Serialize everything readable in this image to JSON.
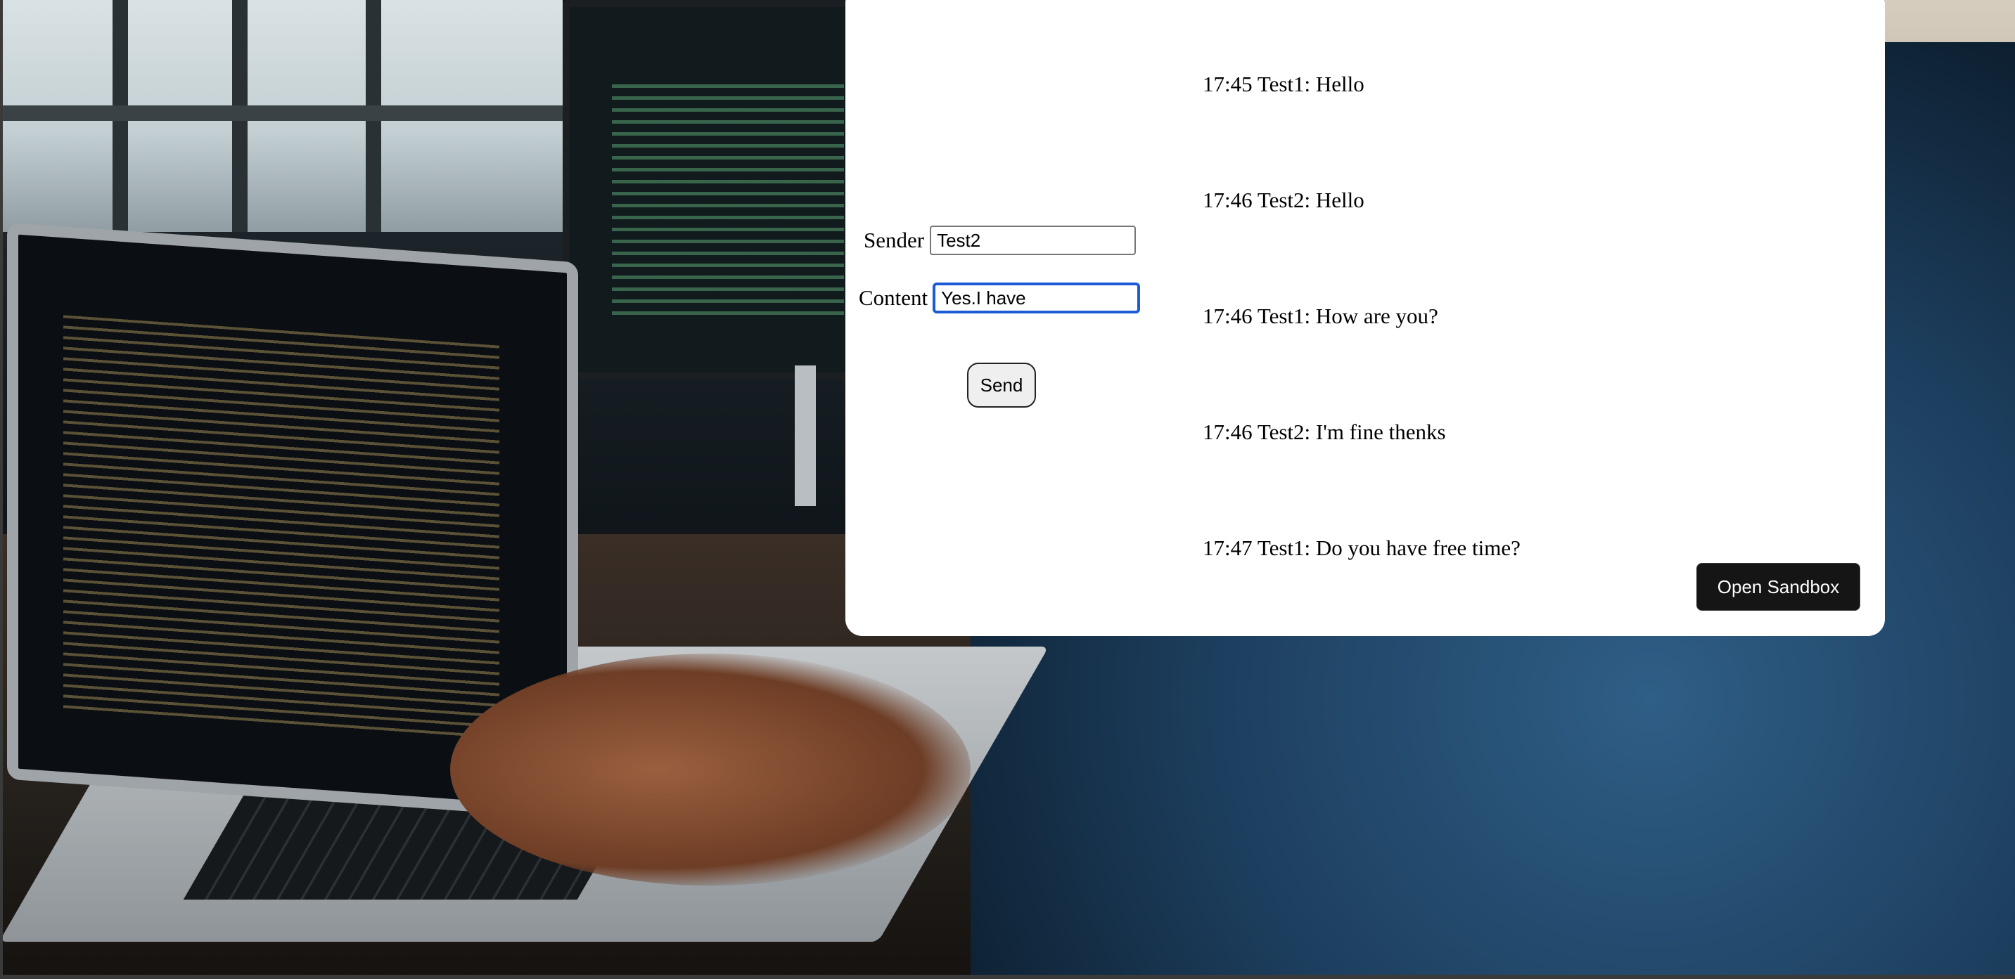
{
  "form": {
    "sender_label": "Sender",
    "sender_value": "Test2",
    "content_label": "Content",
    "content_value": "Yes.I have",
    "send_label": "Send"
  },
  "messages": [
    {
      "time": "17:45",
      "sender": "Test1:",
      "text": "Hello"
    },
    {
      "time": "17:46",
      "sender": "Test2:",
      "text": "Hello"
    },
    {
      "time": "17:46",
      "sender": "Test1:",
      "text": "How are you?"
    },
    {
      "time": "17:46",
      "sender": "Test2:",
      "text": "I'm fine thenks"
    },
    {
      "time": "17:47",
      "sender": "Test1:",
      "text": "Do you have free time?"
    }
  ],
  "sandbox": {
    "label": "Open Sandbox"
  },
  "colors": {
    "card_background": "#ffffff",
    "focus_ring": "#1b5cd6",
    "sandbox_button": "#151515"
  }
}
